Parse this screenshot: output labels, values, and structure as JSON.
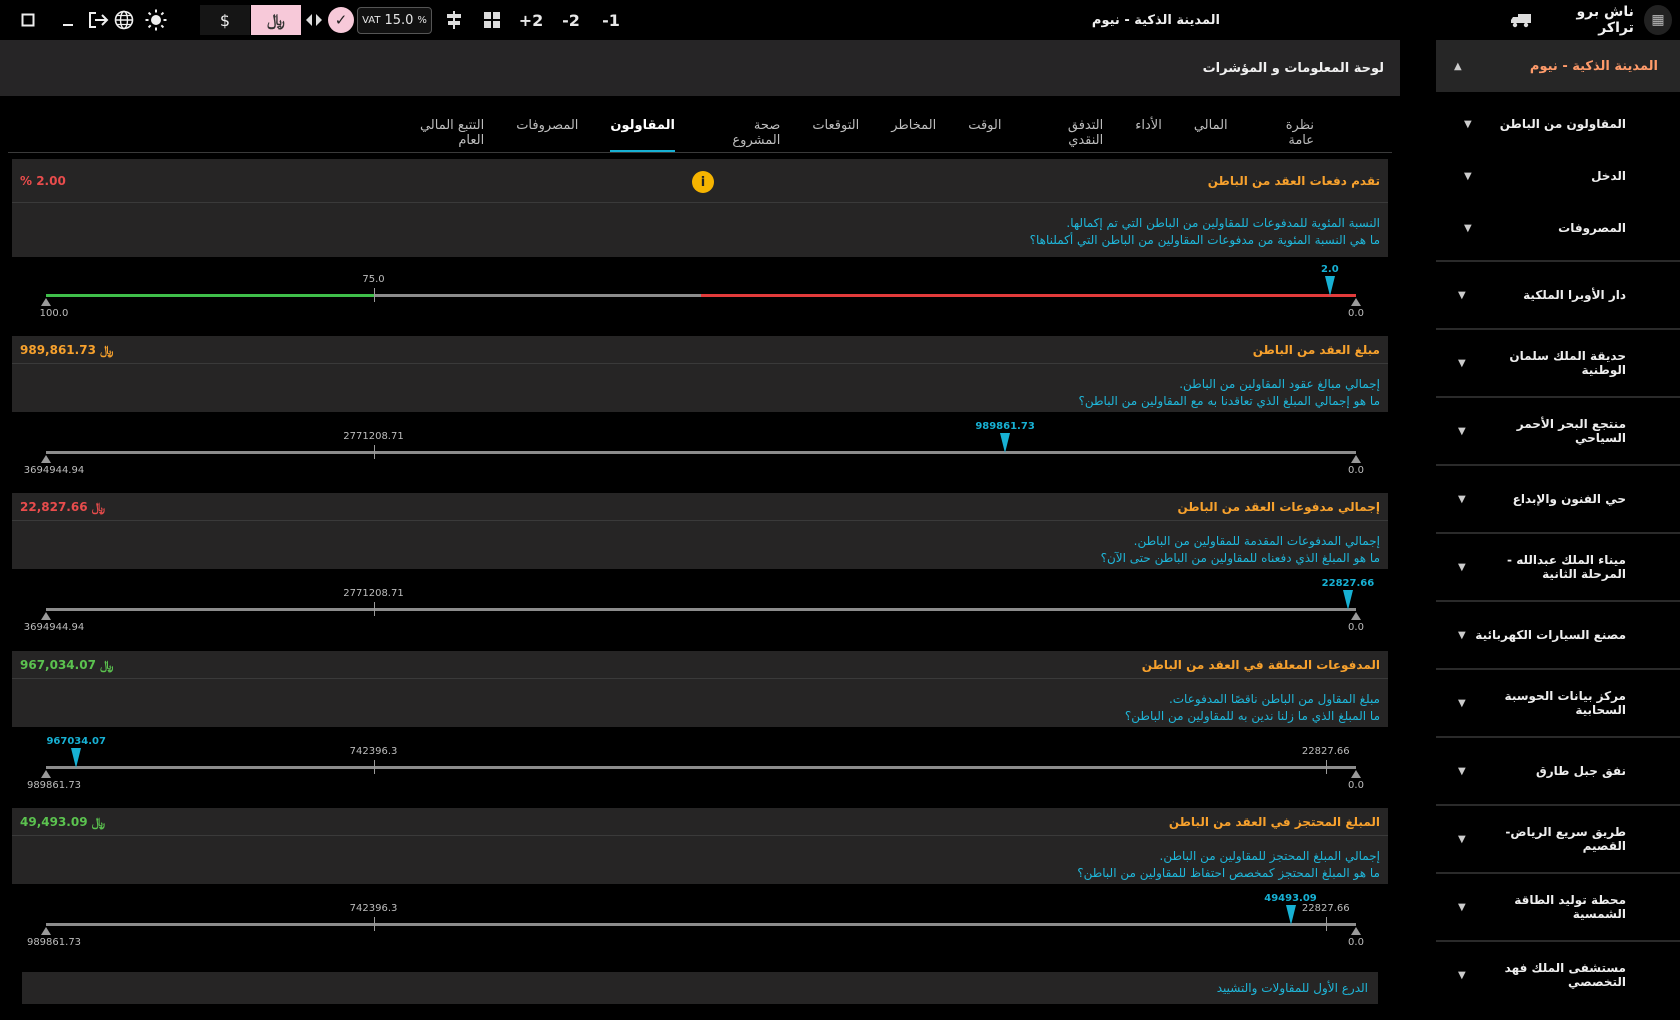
{
  "topbar": {
    "brand_name": "ناش برو تراكر",
    "title": "المدينة الذكية - نيوم",
    "vat_label": "VAT",
    "vat_value": "15.0",
    "vat_unit": "%",
    "currency_usd": "$",
    "currency_sar": "﷼",
    "btn_minus1": "-1",
    "btn_minus2": "-2",
    "btn_plus2": "+2",
    "icons": [
      "square-icon",
      "minimize-icon",
      "logout-icon",
      "globe-icon",
      "sun-icon",
      "code-arrows-icon",
      "check-icon",
      "balance-icon",
      "grid-icon",
      "truck-icon"
    ]
  },
  "sidebar": {
    "project": "المدينة الذكية - نيوم",
    "subitems": [
      "المقاولون من الباطن",
      "الدخل",
      "المصروفات"
    ],
    "projects": [
      "دار الأوبرا الملكية",
      "حديقة الملك سلمان الوطنية",
      "منتجع البحر الأحمر السياحي",
      "حي الفنون والإبداع",
      "ميناء الملك عبدالله - المرحلة الثانية",
      "مصنع السيارات الكهربائية",
      "مركز بيانات الحوسبة السحابية",
      "نفق جبل طارق",
      "طريق سريع الرياض-القصيم",
      "محطة توليد الطاقة الشمسية",
      "مستشفى الملك فهد التخصصي"
    ]
  },
  "panel": {
    "title": "لوحة المعلومات و المؤشرات"
  },
  "tabs": [
    "نظرة عامة",
    "المالي",
    "الأداء",
    "التدفق النقدي",
    "الوقت",
    "المخاطر",
    "التوقعات",
    "صحة المشروع",
    "المقاولون",
    "المصروفات",
    "التتبع المالي العام"
  ],
  "active_tab": "المقاولون",
  "cards": [
    {
      "title": "تقدم دفعات العقد من الباطن",
      "value": "% 2.00",
      "value_color": "#e84c4c",
      "desc1": "النسبة المئوية للمدفوعات للمقاولين من الباطن التي تم إكمالها.",
      "desc2": "ما هي النسبة المئوية من مدفوعات المقاولين من الباطن التي أكملناها؟"
    },
    {
      "title": "مبلغ العقد من الباطن",
      "value": "989,861.73 ﷼",
      "value_color": "#f7a12d",
      "desc1": "إجمالي مبالغ عقود المقاولين من الباطن.",
      "desc2": "ما هو إجمالي المبلغ الذي تعاقدنا به مع المقاولين من الباطن؟"
    },
    {
      "title": "إجمالي مدفوعات العقد من الباطن",
      "value": "22,827.66 ﷼",
      "value_color": "#e84c4c",
      "desc1": "إجمالي المدفوعات المقدمة للمقاولين من الباطن.",
      "desc2": "ما هو المبلغ الذي دفعناه للمقاولين من الباطن حتى الآن؟"
    },
    {
      "title": "المدفوعات المعلقة في العقد من الباطن",
      "value": "967,034.07 ﷼",
      "value_color": "#5bc24f",
      "desc1": "مبلغ المقاول من الباطن ناقصًا المدفوعات.",
      "desc2": "ما المبلغ الذي ما زلنا ندين به للمقاولين من الباطن؟"
    },
    {
      "title": "المبلغ المحتجز في العقد من الباطن",
      "value": "49,493.09 ﷼",
      "value_color": "#5bc24f",
      "desc1": "إجمالي المبلغ المحتجز للمقاولين من الباطن.",
      "desc2": "ما هو المبلغ المحتجز كمخصص احتفاظ للمقاولين من الباطن؟"
    }
  ],
  "gauges": [
    {
      "min_label": "0.0",
      "max_label": "100.0",
      "mid_label": "75.0",
      "marker_label": "2.0",
      "min": 0,
      "max": 100,
      "mid": 75,
      "marker": 2.0,
      "colored": true
    },
    {
      "min_label": "0.0",
      "max_label": "3694944.94",
      "mid_label": "2771208.71",
      "marker_label": "989861.73",
      "min": 0,
      "max": 3694944.94,
      "mid": 2771208.71,
      "marker": 989861.73
    },
    {
      "min_label": "0.0",
      "max_label": "3694944.94",
      "mid_label": "2771208.71",
      "marker_label": "22827.66",
      "min": 0,
      "max": 3694944.94,
      "mid": 2771208.71,
      "marker": 22827.66
    },
    {
      "min_label": "0.0",
      "max_label": "989861.73",
      "mid_label": "742396.3",
      "low_label": "22827.66",
      "marker_label": "967034.07",
      "min": 0,
      "max": 989861.73,
      "mid": 742396.3,
      "low": 22827.66,
      "marker": 967034.07
    },
    {
      "min_label": "0.0",
      "max_label": "989861.73",
      "mid_label": "742396.3",
      "low_label": "22827.66",
      "marker_label": "49493.09",
      "min": 0,
      "max": 989861.73,
      "mid": 742396.3,
      "low": 22827.66,
      "marker": 49493.09
    }
  ],
  "footer_card_title": "الدرع الأول للمقاولات والتشييد"
}
